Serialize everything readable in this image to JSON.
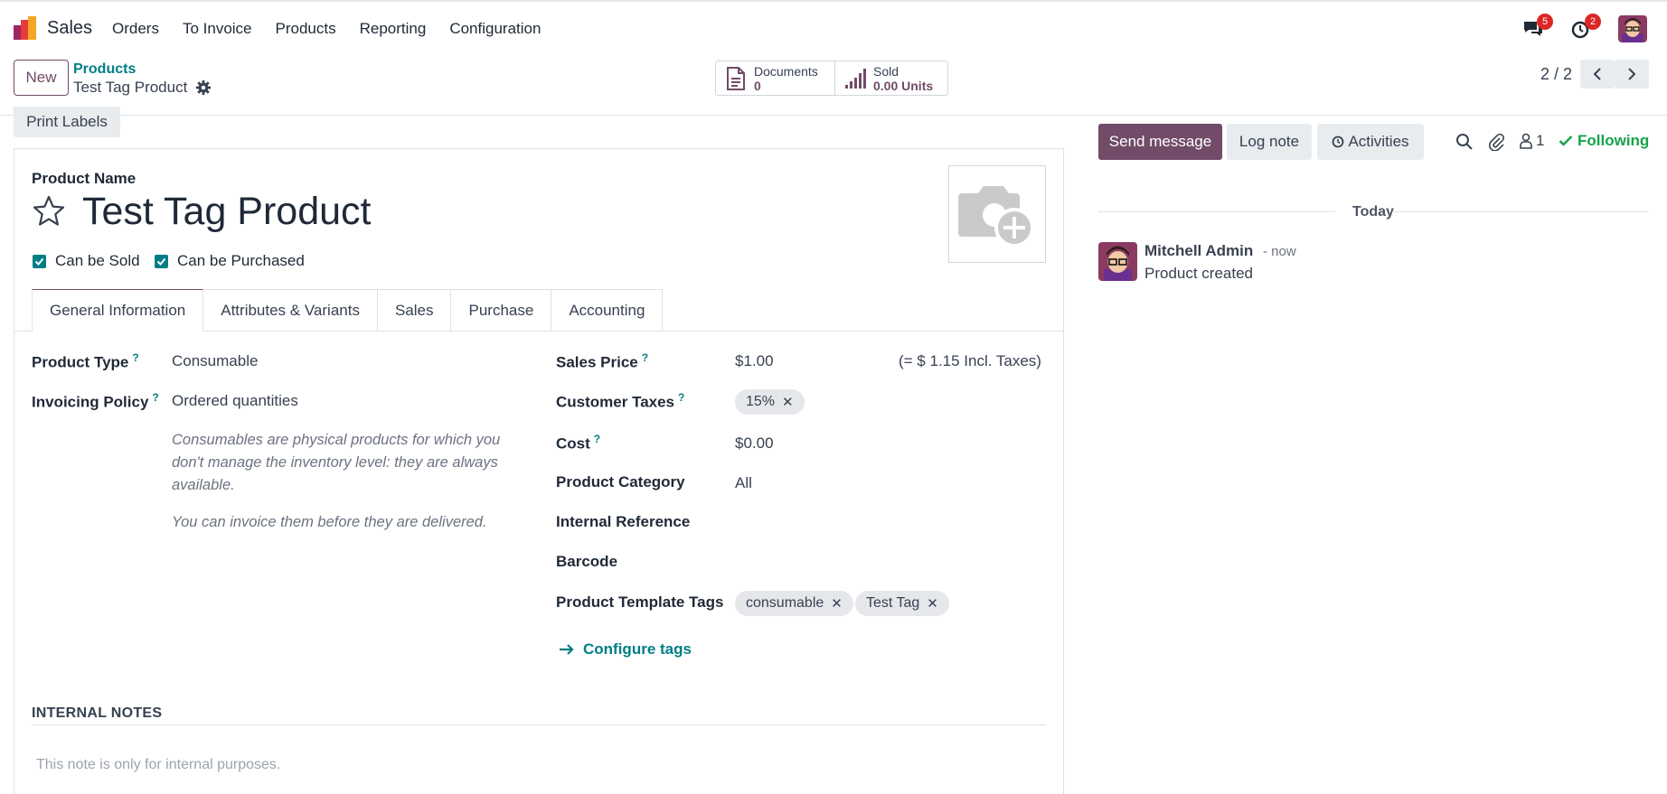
{
  "navbar": {
    "app_name": "Sales",
    "menu": [
      "Orders",
      "To Invoice",
      "Products",
      "Reporting",
      "Configuration"
    ],
    "messages_badge": "5",
    "activities_badge": "2"
  },
  "control": {
    "new_label": "New",
    "breadcrumb_parent": "Products",
    "breadcrumb_current": "Test Tag Product",
    "smart_buttons": {
      "documents_label": "Documents",
      "documents_value": "0",
      "sold_label": "Sold",
      "sold_value": "0.00 Units"
    },
    "pager": "2 / 2"
  },
  "form": {
    "print_labels": "Print Labels",
    "product_name_label": "Product Name",
    "product_name": "Test Tag Product",
    "can_be_sold": "Can be Sold",
    "can_be_purchased": "Can be Purchased",
    "tabs": [
      "General Information",
      "Attributes & Variants",
      "Sales",
      "Purchase",
      "Accounting"
    ],
    "product_type_label": "Product Type",
    "product_type": "Consumable",
    "invoicing_policy_label": "Invoicing Policy",
    "invoicing_policy": "Ordered quantities",
    "help_1": "Consumables are physical products for which you don't manage the inventory level: they are always available.",
    "help_2": "You can invoice them before they are delivered.",
    "sales_price_label": "Sales Price",
    "sales_price": "$1.00",
    "incl_taxes": "(= $ 1.15 Incl. Taxes)",
    "customer_taxes_label": "Customer Taxes",
    "customer_taxes_tag": "15%",
    "cost_label": "Cost",
    "cost": "$0.00",
    "product_category_label": "Product Category",
    "product_category": "All",
    "internal_reference_label": "Internal Reference",
    "barcode_label": "Barcode",
    "template_tags_label": "Product Template Tags",
    "template_tags": [
      "consumable",
      "Test Tag"
    ],
    "configure_tags": "Configure tags",
    "internal_notes_title": "INTERNAL NOTES",
    "internal_notes_placeholder": "This note is only for internal purposes.",
    "help_marker": "?"
  },
  "chatter": {
    "send_message": "Send message",
    "log_note": "Log note",
    "activities": "Activities",
    "followers_count": "1",
    "following": "Following",
    "today": "Today",
    "author": "Mitchell Admin",
    "time": "- now",
    "body": "Product created"
  },
  "colors": {
    "primary": "#714B67",
    "link": "#017e84",
    "success": "#16a34a",
    "badge": "#dc2626"
  }
}
